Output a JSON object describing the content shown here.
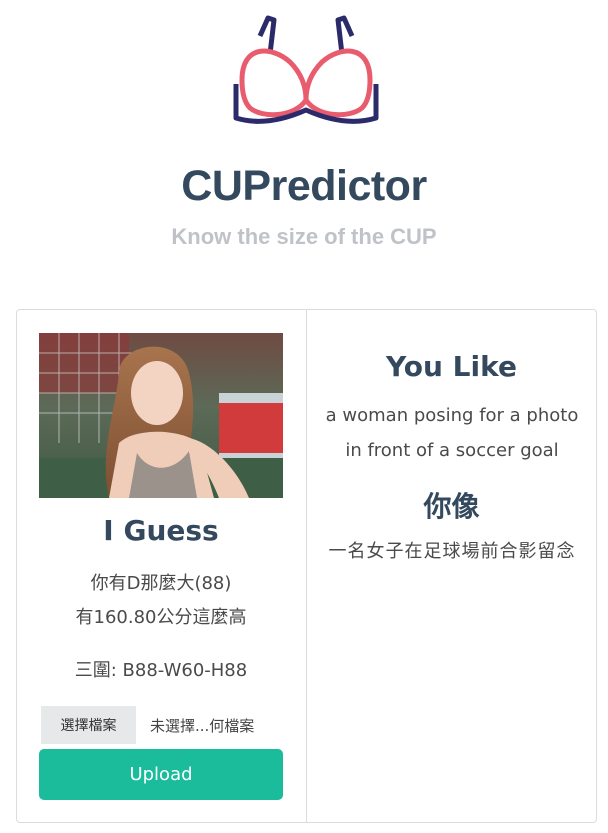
{
  "header": {
    "logo_icon": "bra-icon",
    "brand": "CUPredictor",
    "tagline": "Know the size of the CUP"
  },
  "left_panel": {
    "photo_alt": "uploaded photo",
    "heading": "I Guess",
    "cup_line": "你有D那麼大(88)",
    "height_line": "有160.80公分這麼高",
    "measurements_line": "三圍: B88-W60-H88",
    "file_button": "選擇檔案",
    "file_name": "未選擇...何檔案",
    "upload_button": "Upload"
  },
  "right_panel": {
    "heading_en": "You Like",
    "description_en": "a woman posing for a photo in front of a soccer goal",
    "heading_zh": "你像",
    "description_zh": "一名女子在足球場前合影留念"
  },
  "colors": {
    "brand_dark": "#34495e",
    "tagline_gray": "#bfc3c8",
    "accent_green": "#1abc9c",
    "bra_pink": "#e85c6e",
    "bra_navy": "#2b2a6b"
  }
}
